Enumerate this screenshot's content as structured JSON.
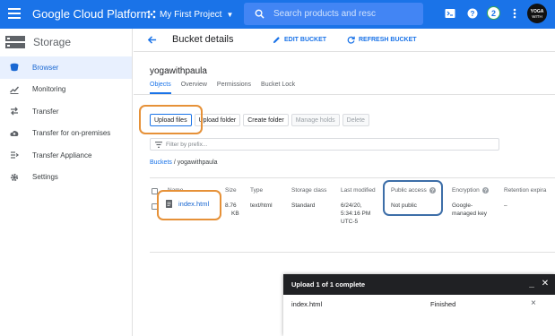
{
  "topbar": {
    "app_title": "Google Cloud Platform",
    "project_name": "My First Project",
    "search_placeholder": "Search products and resc",
    "notification_count": "2",
    "avatar_text": "YOGA WITH PAULA",
    "brand_color": "#1a73e8"
  },
  "sidebar": {
    "title": "Storage",
    "items": [
      {
        "label": "Browser",
        "icon": "bucket-icon",
        "active": true
      },
      {
        "label": "Monitoring",
        "icon": "chart-icon"
      },
      {
        "label": "Transfer",
        "icon": "transfer-icon"
      },
      {
        "label": "Transfer for on-premises",
        "icon": "cloud-upload-icon"
      },
      {
        "label": "Transfer Appliance",
        "icon": "appliance-icon"
      },
      {
        "label": "Settings",
        "icon": "gear-icon"
      }
    ]
  },
  "header": {
    "title": "Bucket details",
    "edit_label": "EDIT BUCKET",
    "refresh_label": "REFRESH BUCKET"
  },
  "bucket": {
    "name": "yogawithpaula",
    "tabs": [
      "Objects",
      "Overview",
      "Permissions",
      "Bucket Lock"
    ],
    "active_tab": "Objects"
  },
  "actions": {
    "upload_files": "Upload files",
    "upload_folder": "Upload folder",
    "create_folder": "Create folder",
    "manage_holds": "Manage holds",
    "delete": "Delete"
  },
  "filter": {
    "placeholder": "Filter by prefix..."
  },
  "breadcrumb": {
    "root": "Buckets",
    "separator": "/",
    "current": "yogawithpaula"
  },
  "table": {
    "columns": [
      "Name",
      "Size",
      "Type",
      "Storage class",
      "Last modified",
      "Public access",
      "Encryption",
      "Retention expira"
    ],
    "rows": [
      {
        "name": "index.html",
        "size_line1": "8.76",
        "size_line2": "KB",
        "type": "text/html",
        "storage_class": "Standard",
        "modified_line1": "6/24/20,",
        "modified_line2": "5:34:16 PM",
        "modified_line3": "UTC-5",
        "public_access": "Not public",
        "encryption_line1": "Google-",
        "encryption_line2": "managed key",
        "retention": "–"
      }
    ]
  },
  "upload_panel": {
    "title": "Upload 1 of 1 complete",
    "file": "index.html",
    "status": "Finished"
  },
  "annotation_colors": {
    "orange": "#e69138",
    "blue": "#3d6ea8"
  }
}
